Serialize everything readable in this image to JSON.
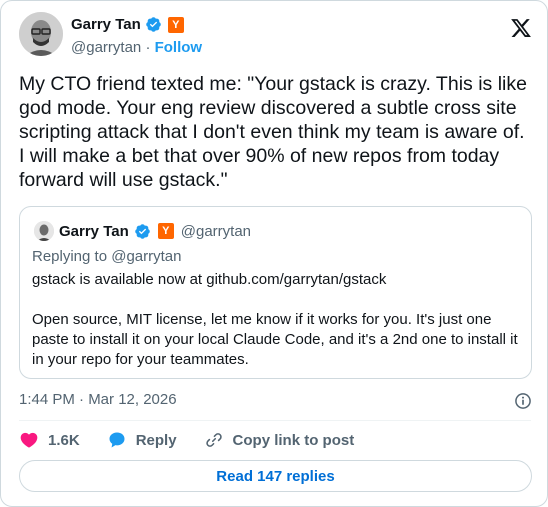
{
  "author": {
    "name": "Garry Tan",
    "handle": "@garrytan",
    "separator": "·",
    "follow_label": "Follow",
    "yc_badge": "Y"
  },
  "tweet": {
    "text": "My CTO friend texted me: \"Your gstack is crazy. This is like god mode. Your eng review discovered a subtle cross site scripting attack that I don't even think my team is aware of. I will make a bet that over 90% of new repos from today forward will use gstack.\""
  },
  "quote": {
    "name": "Garry Tan",
    "handle": "@garrytan",
    "yc_badge": "Y",
    "replying_to": "Replying to @garrytan",
    "text": "gstack is available now at github.com/garrytan/gstack\n\nOpen source, MIT license, let me know if it works for you. It's just one paste to install it on your local Claude Code, and it's a 2nd one to install it in your repo for your teammates."
  },
  "meta": {
    "timestamp": "1:44 PM · Mar 12, 2026"
  },
  "actions": {
    "like_count": "1.6K",
    "reply_label": "Reply",
    "copy_link_label": "Copy link to post"
  },
  "read_replies_label": "Read 147 replies",
  "colors": {
    "accent": "#1d9bf0",
    "like": "#f91880",
    "yc": "#ff6600",
    "secondary_text": "#536471"
  },
  "icons": [
    "verified-badge-icon",
    "yc-badge-icon",
    "x-logo-icon",
    "info-icon",
    "heart-icon",
    "reply-bubble-icon",
    "link-icon"
  ]
}
